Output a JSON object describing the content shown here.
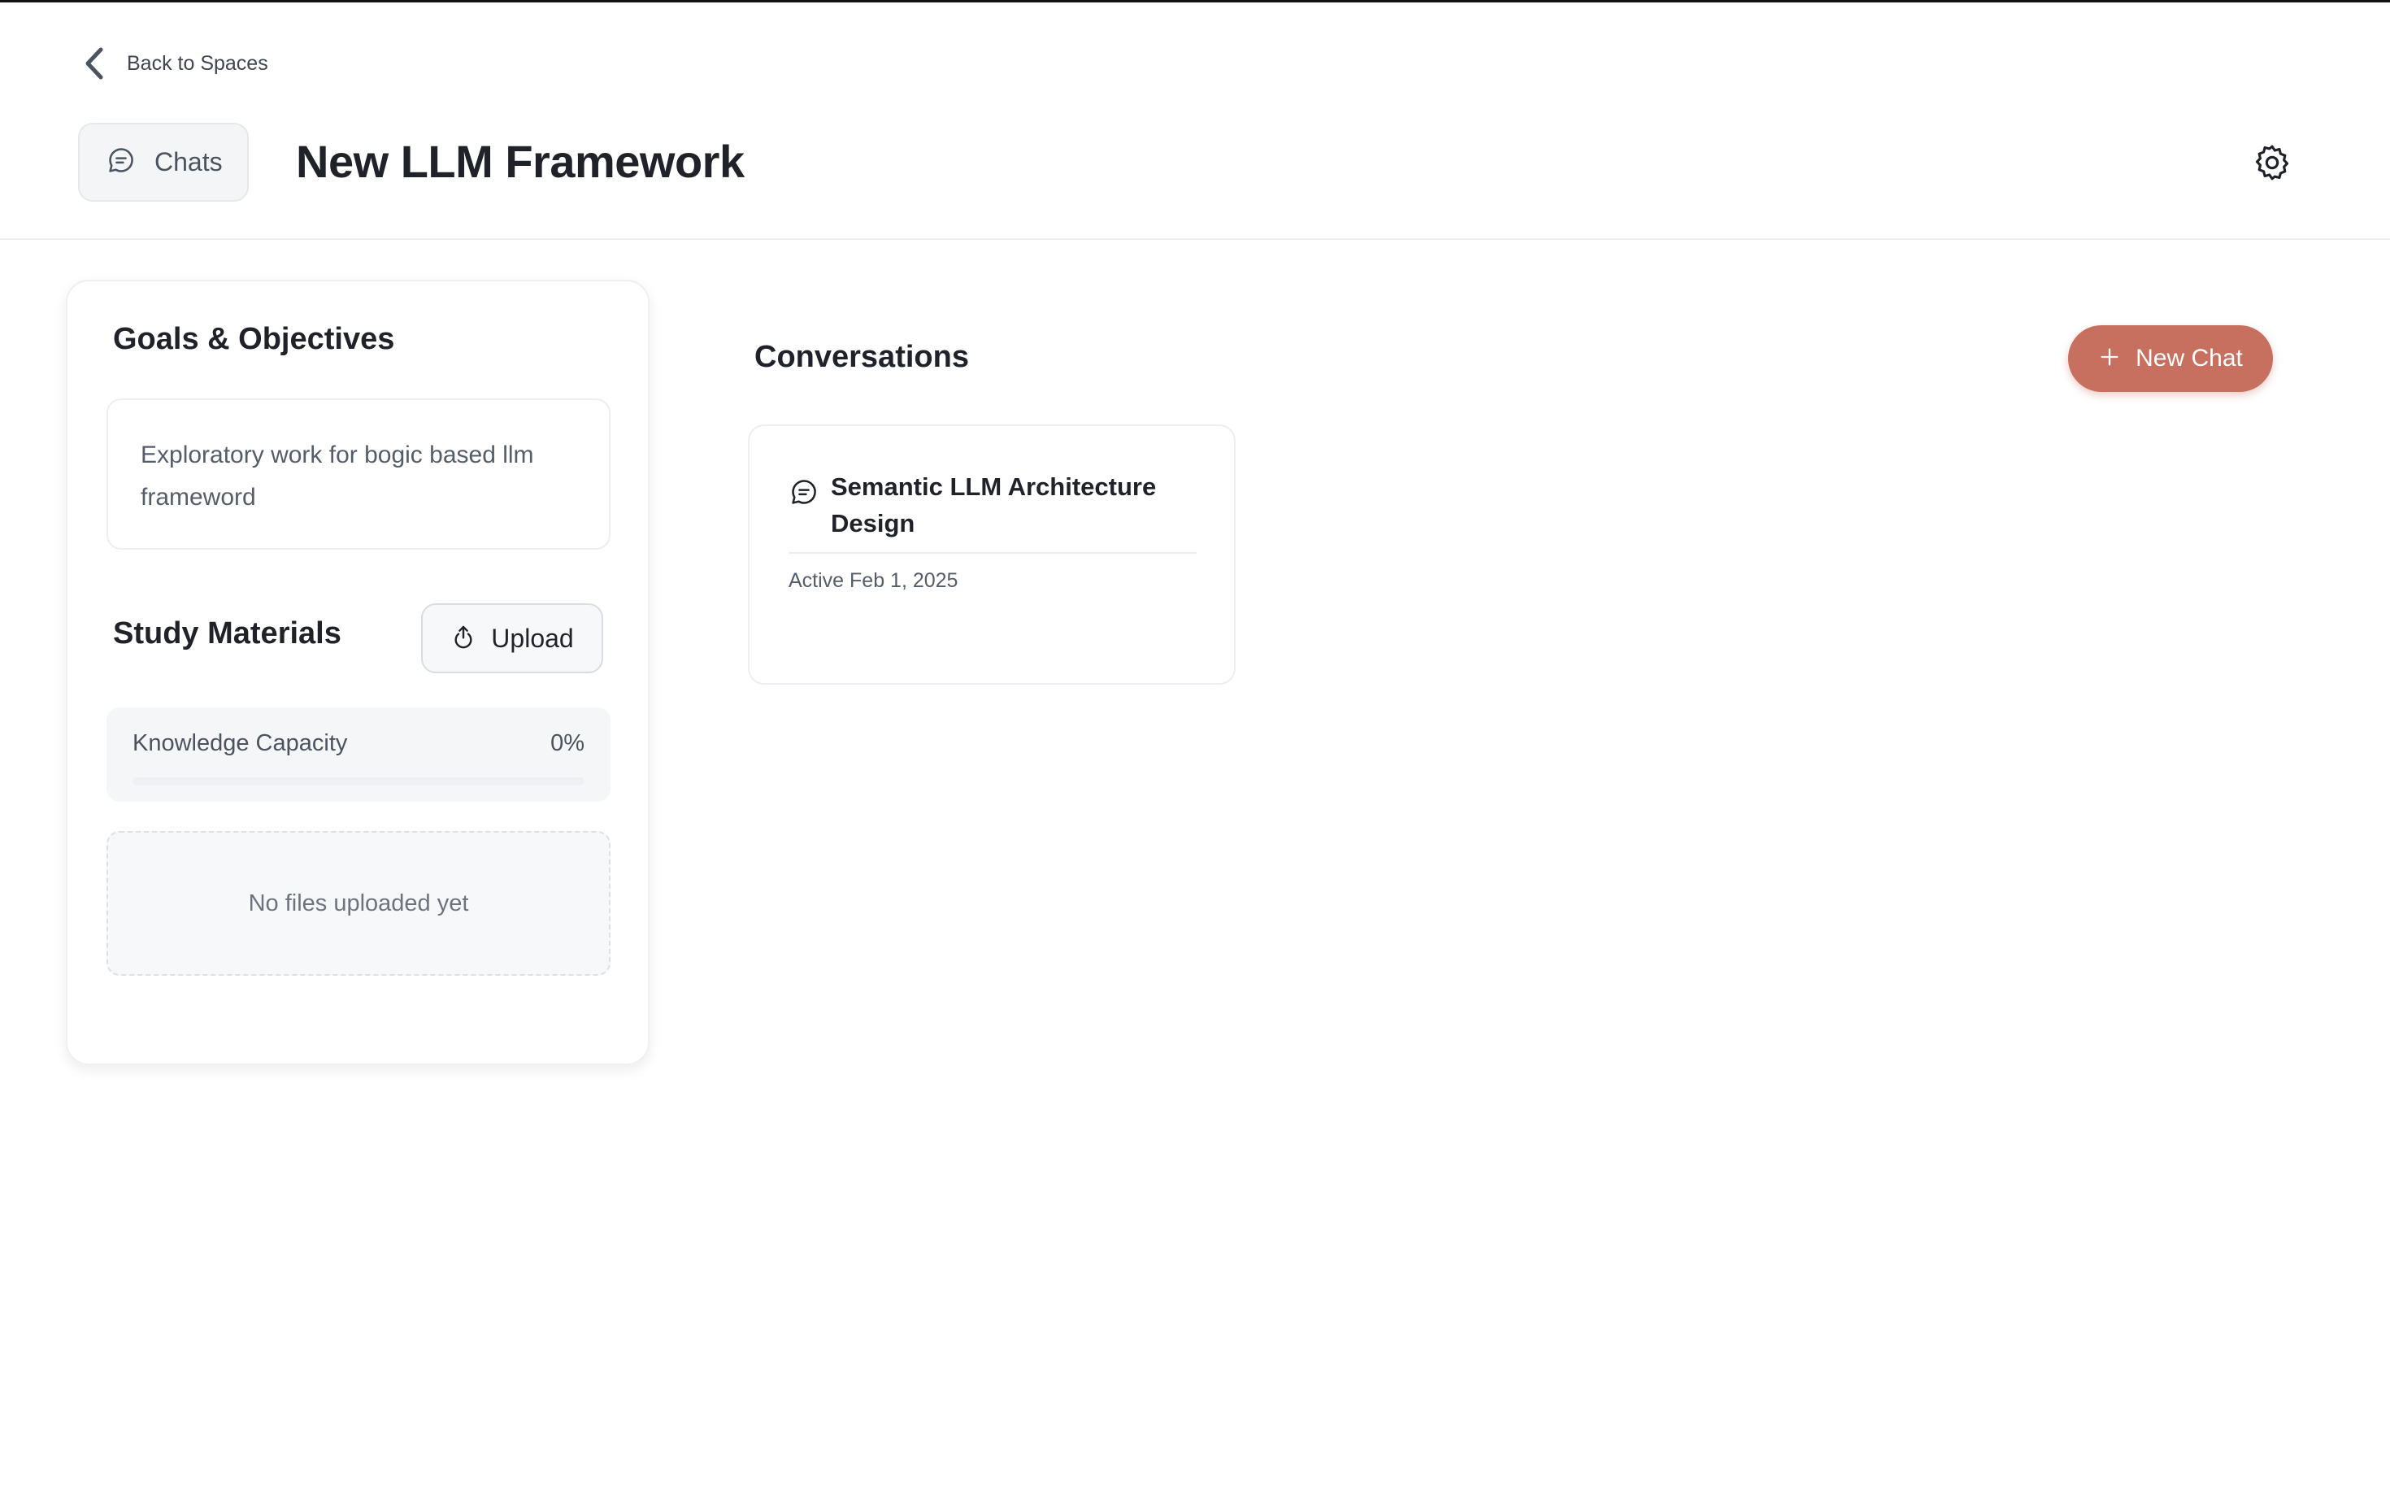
{
  "nav": {
    "back_label": "Back to Spaces",
    "chats_label": "Chats"
  },
  "page": {
    "title": "New LLM Framework"
  },
  "goals": {
    "heading": "Goals & Objectives",
    "text": "Exploratory work for bogic based llm frameword"
  },
  "study": {
    "heading": "Study Materials",
    "upload_label": "Upload",
    "capacity_label": "Knowledge Capacity",
    "capacity_value": "0%",
    "capacity_fraction": 0,
    "empty_text": "No files uploaded yet"
  },
  "conversations": {
    "heading": "Conversations",
    "new_chat_label": "New Chat",
    "items": [
      {
        "title": "Semantic LLM Architecture Design",
        "meta": "Active Feb 1, 2025"
      }
    ]
  },
  "icons": {
    "back": "chevron-left-icon",
    "chats": "chat-bubble-icon",
    "settings": "gear-icon",
    "upload": "upload-icon",
    "new_chat": "plus-icon",
    "conversation": "chat-bubble-icon"
  },
  "colors": {
    "accent": "#c8705f",
    "text": "#1f2329",
    "muted": "#555d68"
  }
}
